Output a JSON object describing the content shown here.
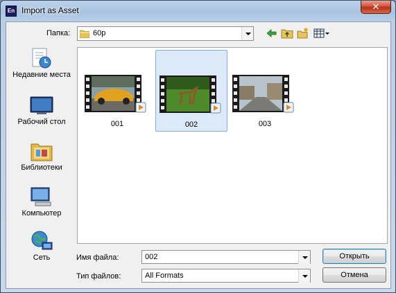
{
  "window": {
    "title": "Import as Asset",
    "app_icon_text": "En",
    "close_glyph": "✕"
  },
  "toolbar": {
    "look_in_label": "Папка:",
    "look_in_value": "60p",
    "icons": [
      "back-arrow-icon",
      "up-folder-icon",
      "new-folder-icon",
      "view-menu-icon"
    ]
  },
  "places": [
    {
      "label": "Недавние места",
      "icon": "recent-places-icon"
    },
    {
      "label": "Рабочий стол",
      "icon": "desktop-icon"
    },
    {
      "label": "Библиотеки",
      "icon": "libraries-icon"
    },
    {
      "label": "Компьютер",
      "icon": "computer-icon"
    },
    {
      "label": "Сеть",
      "icon": "network-icon"
    }
  ],
  "files": [
    {
      "name": "001",
      "selected": false
    },
    {
      "name": "002",
      "selected": true
    },
    {
      "name": "003",
      "selected": false
    }
  ],
  "filename": {
    "label": "Имя файла:",
    "value": "002"
  },
  "filetype": {
    "label": "Тип файлов:",
    "value": "All Formats"
  },
  "buttons": {
    "open": "Открыть",
    "cancel": "Отмена"
  },
  "colors": {
    "selection": "#dce9f8",
    "selection_border": "#84acdd",
    "close": "#c8432a"
  }
}
